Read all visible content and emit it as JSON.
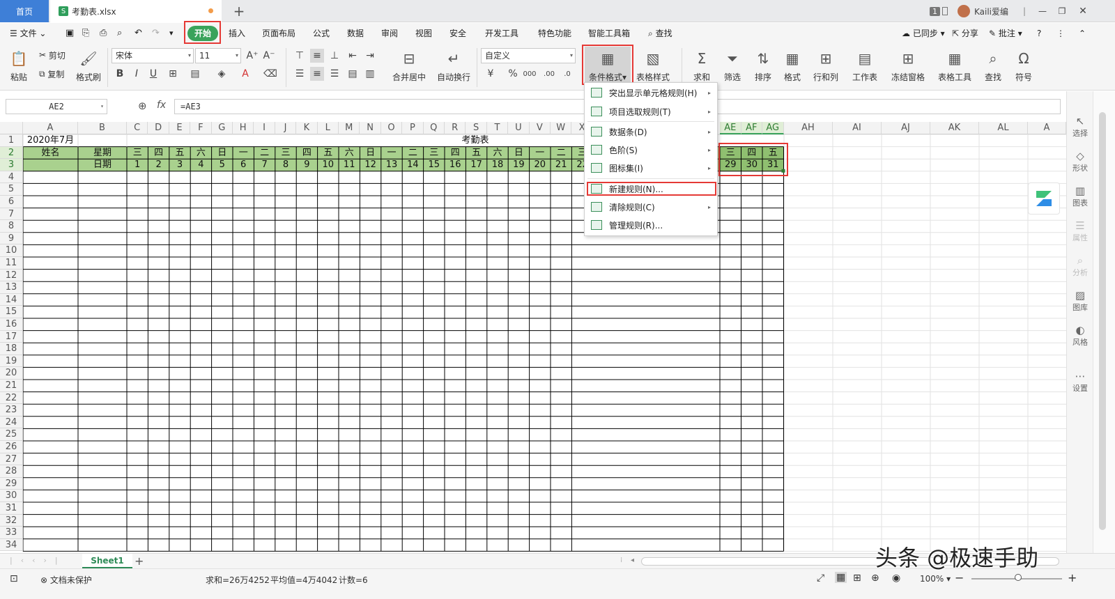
{
  "tabs": {
    "home": "首页",
    "file": "考勤表.xlsx",
    "new_tab": "+"
  },
  "topright": {
    "badge": "1",
    "user": "Kaili爱编"
  },
  "menu": {
    "file": "文件",
    "items": [
      "开始",
      "插入",
      "页面布局",
      "公式",
      "数据",
      "审阅",
      "视图",
      "安全",
      "开发工具",
      "特色功能",
      "智能工具箱"
    ],
    "search": "查找",
    "sync": "已同步",
    "share": "分享",
    "comment": "批注"
  },
  "ribbon": {
    "paste": "粘贴",
    "cut": "剪切",
    "copy": "复制",
    "format_painter": "格式刷",
    "font_name": "宋体",
    "font_size": "11",
    "merge_center": "合并居中",
    "wrap": "自动换行",
    "number_format": "自定义",
    "cond_format": "条件格式",
    "table_style": "表格样式",
    "sum": "求和",
    "filter": "筛选",
    "sort": "排序",
    "format": "格式",
    "rowcol": "行和列",
    "worksheet": "工作表",
    "freeze": "冻结窗格",
    "table_tools": "表格工具",
    "find": "查找",
    "symbol": "符号"
  },
  "formula": {
    "name_box": "AE2",
    "fx": "fx",
    "value": "=AE3"
  },
  "columns": [
    "A",
    "B",
    "C",
    "D",
    "E",
    "F",
    "G",
    "H",
    "I",
    "J",
    "K",
    "L",
    "M",
    "N",
    "O",
    "P",
    "Q",
    "R",
    "S",
    "T",
    "U",
    "V",
    "W",
    "X",
    "AE",
    "AF",
    "AG",
    "AH",
    "AI",
    "AJ",
    "AK",
    "AL",
    "A"
  ],
  "sheet": {
    "a1": "2020年7月",
    "title": "考勤表",
    "name_header": "姓名",
    "weekday_header": "星期",
    "date_header": "日期",
    "weekdays": [
      "三",
      "四",
      "五",
      "六",
      "日",
      "一",
      "二",
      "三",
      "四",
      "五",
      "六",
      "日",
      "一",
      "二",
      "三",
      "四",
      "五",
      "六",
      "日",
      "一",
      "二",
      "三"
    ],
    "days": [
      "1",
      "2",
      "3",
      "4",
      "5",
      "6",
      "7",
      "8",
      "9",
      "10",
      "11",
      "12",
      "13",
      "14",
      "15",
      "16",
      "17",
      "18",
      "19",
      "20",
      "21",
      "22"
    ],
    "right_weekdays": [
      "三",
      "四",
      "五"
    ],
    "right_days": [
      "29",
      "30",
      "31"
    ],
    "row_count": 34
  },
  "context_menu": [
    {
      "label": "突出显示单元格规则(H)",
      "submenu": true
    },
    {
      "label": "项目选取规则(T)",
      "submenu": true
    },
    {
      "label": "数据条(D)",
      "submenu": true
    },
    {
      "label": "色阶(S)",
      "submenu": true
    },
    {
      "label": "图标集(I)",
      "submenu": true
    },
    {
      "label": "新建规则(N)...",
      "submenu": false
    },
    {
      "label": "清除规则(C)",
      "submenu": true
    },
    {
      "label": "管理规则(R)...",
      "submenu": false
    }
  ],
  "right_panel": [
    "选择",
    "形状",
    "图表",
    "属性",
    "分析",
    "图库",
    "风格",
    "设置"
  ],
  "sheet_tab": "Sheet1",
  "status": {
    "protect": "文档未保护",
    "sum": "求和=26万4252",
    "avg": "平均值=4万4042",
    "count": "计数=6",
    "zoom": "100%"
  },
  "watermark": "头条 @极速手助",
  "colors": {
    "accent": "#3e7fd7",
    "green": "#41a05a",
    "header_fill": "#a9d18e",
    "highlight": "#e53935"
  }
}
